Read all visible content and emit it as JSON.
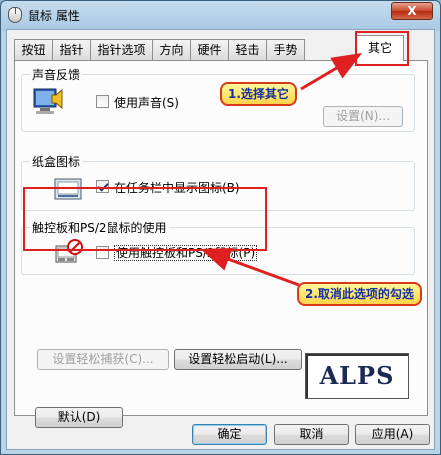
{
  "window": {
    "title": "鼠标 属性",
    "close_label": "X"
  },
  "tabs": [
    {
      "label": "按钮",
      "active": false
    },
    {
      "label": "指针",
      "active": false
    },
    {
      "label": "指针选项",
      "active": false
    },
    {
      "label": "方向",
      "active": false
    },
    {
      "label": "硬件",
      "active": false
    },
    {
      "label": "轻击",
      "active": false
    },
    {
      "label": "手势",
      "active": false
    },
    {
      "label": "其它",
      "active": true
    }
  ],
  "sound_feedback": {
    "legend": "声音反馈",
    "checkbox_label": "使用声音(S)",
    "checked": false,
    "settings_button": "设置(N)..."
  },
  "tray_icon": {
    "legend": "纸盒图标",
    "checkbox_label": "在任务栏中显示图标(B)",
    "checked": true
  },
  "touchpad_ps2": {
    "legend": "触控板和PS/2鼠标的使用",
    "checkbox_label": "使用触控板和PS/2鼠标(P)",
    "checked": false
  },
  "buttons": {
    "easy_capture": "设置轻松捕获(C)...",
    "easy_launch": "设置轻松启动(L)...",
    "defaults": "默认(D)",
    "ok": "确定",
    "cancel": "取消",
    "apply": "应用(A)"
  },
  "logo_text": "ALPS",
  "annotations": {
    "step1": "1.选择其它",
    "step2": "2.取消此选项的勾选",
    "color": "#e02020"
  }
}
